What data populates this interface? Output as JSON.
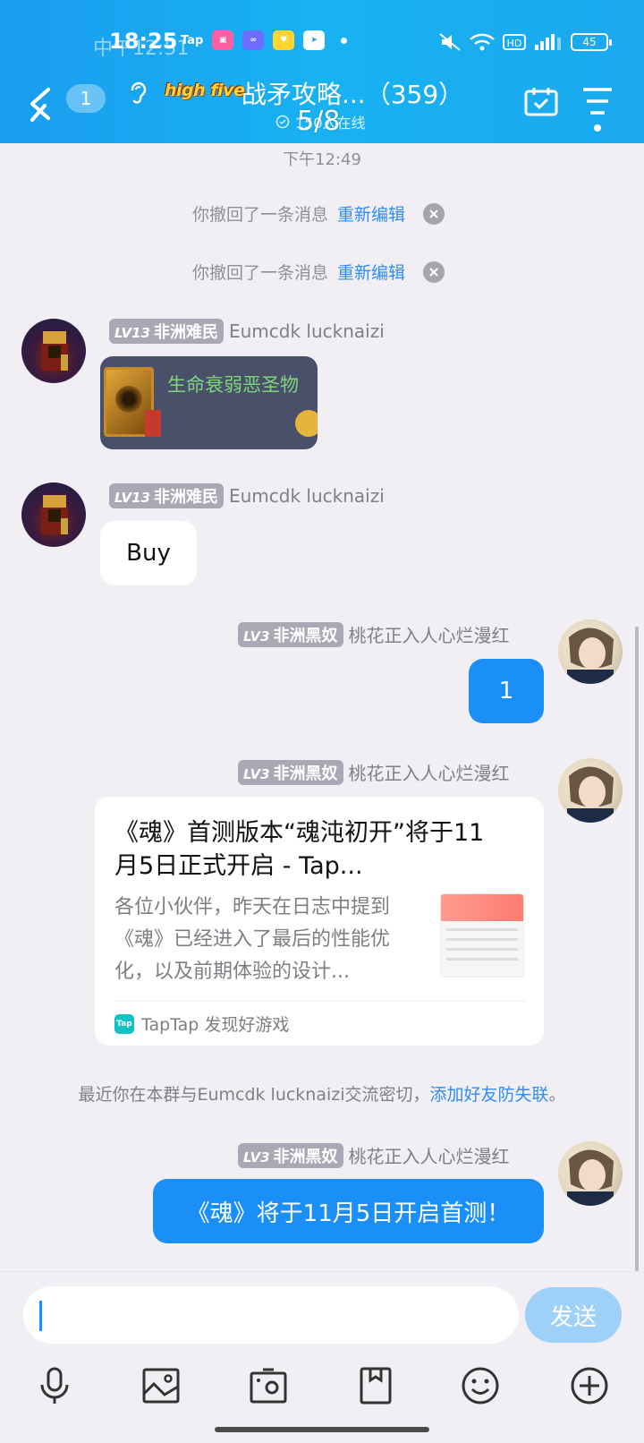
{
  "status_bar": {
    "time_shadow": "中午12:51",
    "time": "18:25",
    "app_tap": "Tap",
    "battery": "45"
  },
  "header": {
    "unread_count": "1",
    "brand": "high five",
    "group_title": "战矛攻略...（359）",
    "online_text": "150人在线",
    "page_indicator": "5/8"
  },
  "chat": {
    "timestamp": "下午12:49",
    "recall_text": "你撤回了一条消息",
    "recall_action": "重新编辑",
    "notice_text": "最近你在本群与Eumcdk lucknaizi交流密切，",
    "notice_link": "添加好友防失联",
    "notice_end": "。",
    "messages": [
      {
        "level_prefix": "LV13",
        "level_title": "非洲难民",
        "sender": "Eumcdk lucknaizi",
        "image_caption": "生命衰弱恶圣物"
      },
      {
        "level_prefix": "LV13",
        "level_title": "非洲难民",
        "sender": "Eumcdk lucknaizi",
        "text": "Buy"
      },
      {
        "level_prefix": "LV3",
        "level_title": "非洲黑奴",
        "sender": "桃花正入人心烂漫红",
        "text": "1"
      },
      {
        "level_prefix": "LV3",
        "level_title": "非洲黑奴",
        "sender": "桃花正入人心烂漫红",
        "card": {
          "title": "《魂》首测版本“魂沌初开”将于11月5日正式开启 - Tap...",
          "description": "各位小伙伴，昨天在日志中提到《魂》已经进入了最后的性能优化，以及前期体验的设计...",
          "source": "TapTap 发现好游戏",
          "source_logo": "Tap"
        }
      },
      {
        "level_prefix": "LV3",
        "level_title": "非洲黑奴",
        "sender": "桃花正入人心烂漫红",
        "text": "《魂》将于11月5日开启首测！"
      }
    ]
  },
  "input": {
    "placeholder": "",
    "send_label": "发送"
  },
  "toolbar": {
    "icons": [
      "microphone-icon",
      "photo-icon",
      "camera-icon",
      "file-icon",
      "emoji-icon",
      "plus-icon"
    ]
  }
}
